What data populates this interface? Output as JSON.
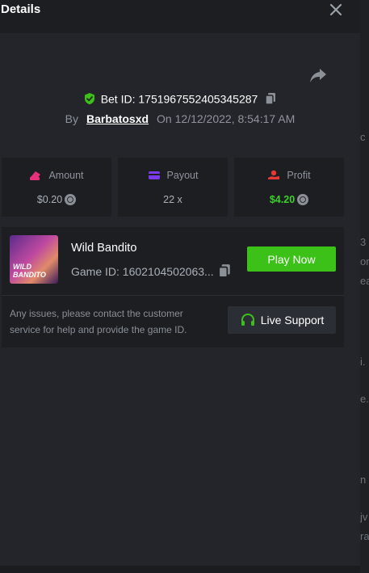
{
  "panel": {
    "title": "Details"
  },
  "bet": {
    "id_label": "Bet ID: 1751967552405345287",
    "by_label": "By",
    "user": "Barbatosxd",
    "on_label": "On",
    "datetime": "12/12/2022, 8:54:17 AM"
  },
  "stats": {
    "amount": {
      "label": "Amount",
      "value": "$0.20",
      "icon": "money-bill-icon",
      "color": "#e8317d"
    },
    "payout": {
      "label": "Payout",
      "value": "22 x",
      "icon": "card-icon",
      "color": "#7c3aed"
    },
    "profit": {
      "label": "Profit",
      "value": "$4.20",
      "icon": "hand-coin-icon",
      "color": "#e53935",
      "value_color": "#3bd12a"
    }
  },
  "game": {
    "name": "Wild Bandito",
    "id_label": "Game ID: 1602104502063...",
    "thumb_text": "WILD BANDITO",
    "play_label": "Play Now",
    "notice": "Any issues, please contact the customer service for help and provide the game ID.",
    "support_label": "Live Support"
  },
  "background_fragments": [
    "c",
    "3",
    "or",
    "ea",
    "i.",
    "e.",
    "n",
    "jv",
    "ra"
  ],
  "colors": {
    "accent": "#3bc117",
    "panel": "#23252a",
    "card": "#1c1e22"
  }
}
